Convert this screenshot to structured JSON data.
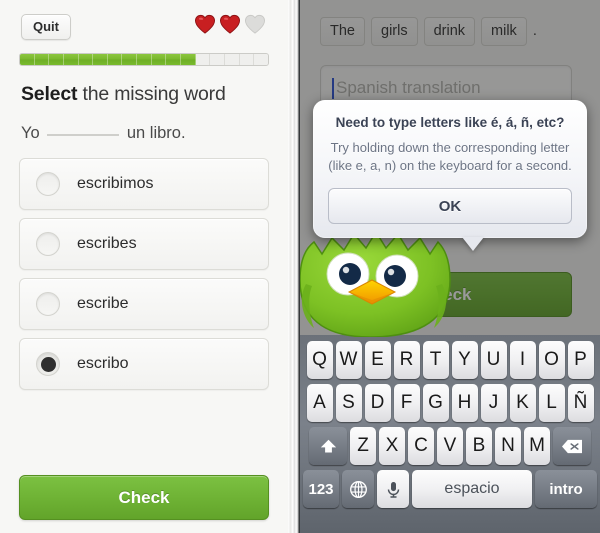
{
  "left": {
    "quit_label": "Quit",
    "hearts": {
      "filled": 2,
      "empty": 1,
      "filled_color": "#cc1f1f",
      "empty_color": "#dcdcdc"
    },
    "progress": {
      "total_segments": 17,
      "filled_segments": 12,
      "fill_color": "#7ab82e",
      "empty_color": "#efefed"
    },
    "prompt_bold": "Select",
    "prompt_rest": " the missing word",
    "sentence_before": "Yo",
    "sentence_after": "un libro.",
    "options": [
      {
        "label": "escribimos",
        "selected": false
      },
      {
        "label": "escribes",
        "selected": false
      },
      {
        "label": "escribe",
        "selected": false
      },
      {
        "label": "escribo",
        "selected": true
      }
    ],
    "check_label": "Check"
  },
  "right": {
    "chips": [
      "The",
      "girls",
      "drink",
      "milk"
    ],
    "punctuation": ".",
    "input_placeholder": "Spanish translation",
    "input_value": "",
    "check_label": "Check",
    "mascot": "duo-owl",
    "dialog": {
      "title": "Need to type letters like é, á, ñ, etc?",
      "body_line1": "Try holding down the corresponding letter",
      "body_line2": "(like e, a, n) on the keyboard for a second.",
      "ok_label": "OK"
    },
    "keyboard": {
      "row1": [
        "Q",
        "W",
        "E",
        "R",
        "T",
        "Y",
        "U",
        "I",
        "O",
        "P"
      ],
      "row2": [
        "A",
        "S",
        "D",
        "F",
        "G",
        "H",
        "J",
        "K",
        "L",
        "Ñ"
      ],
      "row3": [
        "Z",
        "X",
        "C",
        "V",
        "B",
        "N",
        "M"
      ],
      "shift_icon": "shift-icon",
      "backspace_icon": "backspace-icon",
      "num_label": "123",
      "globe_icon": "globe-icon",
      "mic_icon": "microphone-icon",
      "space_label": "espacio",
      "enter_label": "intro"
    }
  }
}
